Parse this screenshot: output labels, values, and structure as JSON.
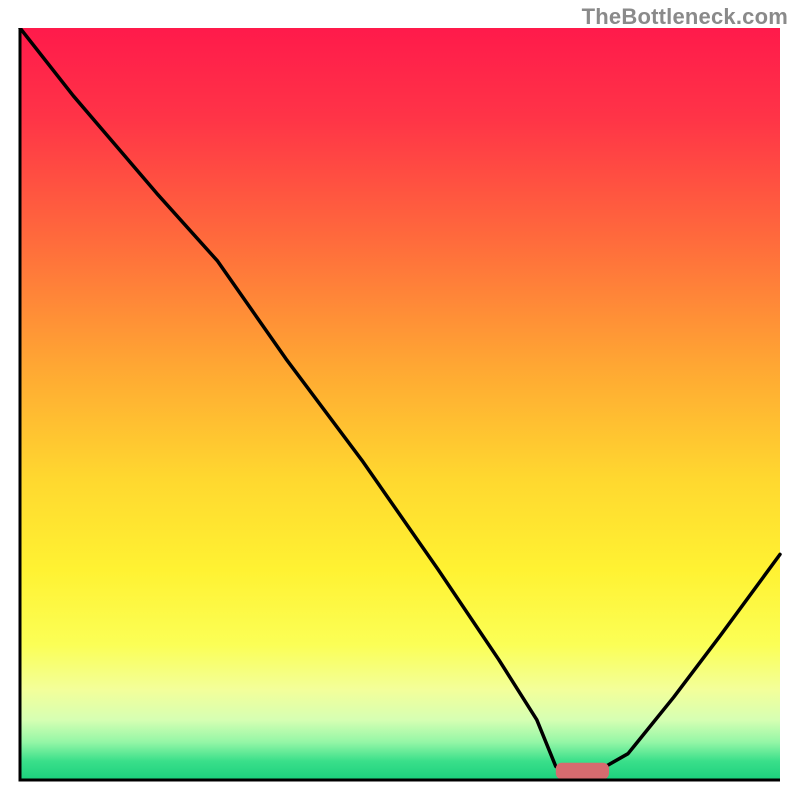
{
  "watermark": "TheBottleneck.com",
  "chart_data": {
    "type": "line",
    "title": "",
    "xlabel": "",
    "ylabel": "",
    "xlim": [
      0,
      100
    ],
    "ylim": [
      0,
      100
    ],
    "grid": false,
    "legend": false,
    "background_gradient": {
      "stops": [
        {
          "offset": 0.0,
          "color": "#ff1a4b"
        },
        {
          "offset": 0.12,
          "color": "#ff3447"
        },
        {
          "offset": 0.28,
          "color": "#ff6a3c"
        },
        {
          "offset": 0.45,
          "color": "#ffa733"
        },
        {
          "offset": 0.6,
          "color": "#ffd82f"
        },
        {
          "offset": 0.72,
          "color": "#fff232"
        },
        {
          "offset": 0.82,
          "color": "#fbff56"
        },
        {
          "offset": 0.88,
          "color": "#f3ff9a"
        },
        {
          "offset": 0.92,
          "color": "#d6ffb3"
        },
        {
          "offset": 0.95,
          "color": "#93f6a6"
        },
        {
          "offset": 0.975,
          "color": "#3adf8a"
        },
        {
          "offset": 1.0,
          "color": "#1bd07d"
        }
      ]
    },
    "series": [
      {
        "name": "bottleneck-curve",
        "x": [
          0,
          7,
          18,
          26,
          35,
          45,
          55,
          63,
          68,
          70.5,
          73,
          76,
          80,
          86,
          92,
          100
        ],
        "y": [
          100,
          91,
          78,
          69,
          56,
          42.5,
          28,
          16,
          8,
          1.8,
          1.2,
          1.2,
          3.5,
          11,
          19,
          30
        ]
      }
    ],
    "marker": {
      "name": "optimal-range",
      "shape": "rounded-bar",
      "x_center": 74,
      "y_center": 1.2,
      "width": 7,
      "height": 2.2,
      "color": "#d66b6f"
    }
  }
}
